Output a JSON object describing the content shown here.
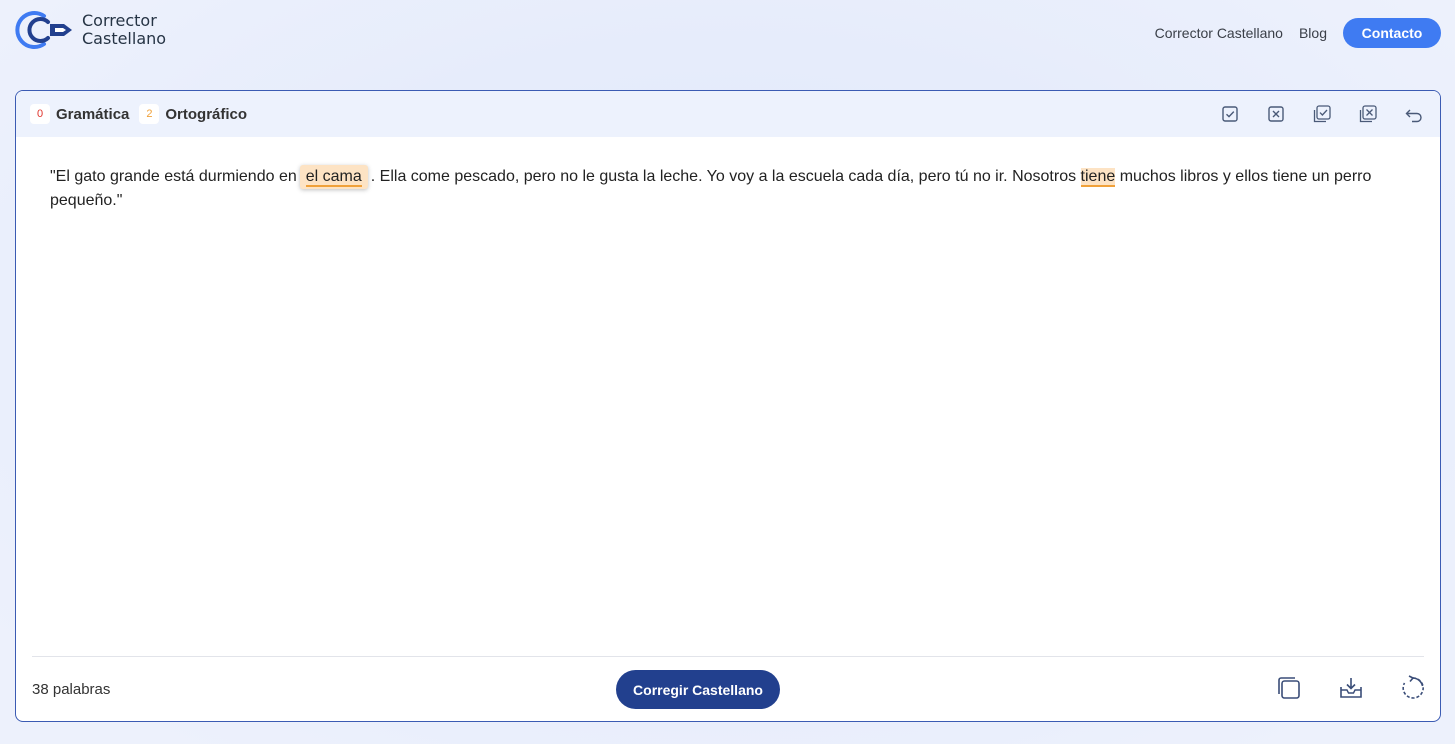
{
  "header": {
    "brand_line1": "Corrector",
    "brand_line2": "Castellano",
    "nav": [
      {
        "label": "Corrector Castellano"
      },
      {
        "label": "Blog"
      }
    ],
    "contact_label": "Contacto"
  },
  "editor": {
    "counters": [
      {
        "count": "0",
        "label": "Gramática",
        "color": "#e0342c"
      },
      {
        "count": "2",
        "label": "Ortográfico",
        "color": "#f0a13a"
      }
    ],
    "toolbar_icons": [
      "accept-icon",
      "reject-icon",
      "accept-all-icon",
      "reject-all-icon",
      "undo-icon"
    ],
    "text": {
      "part1": "\"El gato grande está durmiendo en",
      "error1": "el cama",
      "part2": ". Ella come pescado, pero no le gusta la leche. Yo voy a la escuela cada día, pero tú no ir. Nosotros ",
      "error2": "tiene",
      "part3": " muchos libros y ellos tiene un perro pequeño.\""
    },
    "word_count": "38 palabras",
    "submit_label": "Corregir Castellano",
    "footer_icons": [
      "copy-icon",
      "download-icon",
      "reset-icon"
    ],
    "colors": {
      "accent": "#3f7bf2",
      "primary_button": "#22408e",
      "highlight": "#fde3c4",
      "underline": "#f0a13a"
    }
  }
}
